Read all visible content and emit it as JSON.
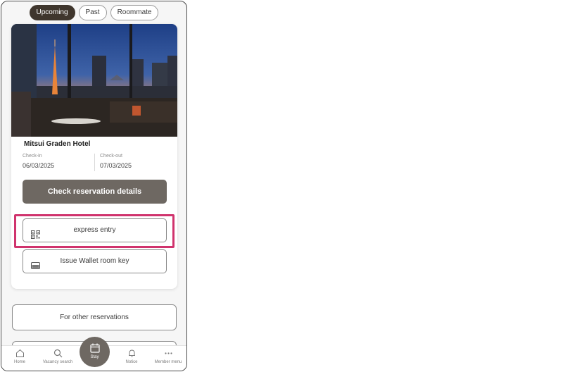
{
  "tabs": [
    {
      "label": "Upcoming",
      "active": true
    },
    {
      "label": "Past",
      "active": false
    },
    {
      "label": "Roommate",
      "active": false
    }
  ],
  "reservation": {
    "hotel_name": "Mitsui Graden Hotel",
    "checkin_label": "Check-in",
    "checkin_date": "06/03/2025",
    "checkout_label": "Check-out",
    "checkout_date": "07/03/2025",
    "details_button": "Check reservation details",
    "express_entry_button": "express entry",
    "express_entry_icon": "qr-code-icon",
    "wallet_button": "Issue Wallet room key",
    "wallet_icon": "wallet-card-icon"
  },
  "other_reservations_button": "For other reservations",
  "bottom_nav": {
    "home": "Home",
    "vacancy_search": "Vacancy search",
    "stay": "Stay",
    "notice": "Notice",
    "member_menu": "Member menu"
  },
  "colors": {
    "active_tab": "#3f362d",
    "primary_button": "#6e6862",
    "highlight": "#d0336d"
  }
}
